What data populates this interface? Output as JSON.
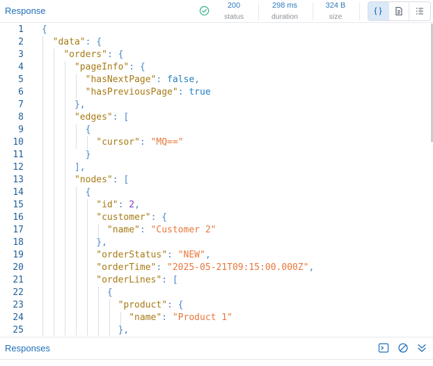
{
  "panel": {
    "title": "Response"
  },
  "stats": {
    "status_value": "200",
    "status_label": "status",
    "duration_value": "298 ms",
    "duration_label": "duration",
    "size_value": "324 B",
    "size_label": "size"
  },
  "colors": {
    "accent": "#1c6fb8",
    "success": "#3fb68b"
  },
  "line_numbers": [
    "1",
    "2",
    "3",
    "4",
    "5",
    "6",
    "7",
    "8",
    "9",
    "10",
    "11",
    "12",
    "13",
    "14",
    "15",
    "16",
    "17",
    "18",
    "19",
    "20",
    "21",
    "22",
    "23",
    "24",
    "25"
  ],
  "code": {
    "l1_p": "{",
    "l2_k": "\"data\"",
    "l2_p": ": {",
    "l3_k": "\"orders\"",
    "l3_p": ": {",
    "l4_k": "\"pageInfo\"",
    "l4_p": ": {",
    "l5_k": "\"hasNextPage\"",
    "l5_p": ": ",
    "l5_v": "false",
    "l5_e": ",",
    "l6_k": "\"hasPreviousPage\"",
    "l6_p": ": ",
    "l6_v": "true",
    "l7_p": "},",
    "l8_k": "\"edges\"",
    "l8_p": ": [",
    "l9_p": "{",
    "l10_k": "\"cursor\"",
    "l10_p": ": ",
    "l10_v": "\"MQ==\"",
    "l11_p": "}",
    "l12_p": "],",
    "l13_k": "\"nodes\"",
    "l13_p": ": [",
    "l14_p": "{",
    "l15_k": "\"id\"",
    "l15_p": ": ",
    "l15_v": "2",
    "l15_e": ",",
    "l16_k": "\"customer\"",
    "l16_p": ": {",
    "l17_k": "\"name\"",
    "l17_p": ": ",
    "l17_v": "\"Customer 2\"",
    "l18_p": "},",
    "l19_k": "\"orderStatus\"",
    "l19_p": ": ",
    "l19_v": "\"NEW\"",
    "l19_e": ",",
    "l20_k": "\"orderTime\"",
    "l20_p": ": ",
    "l20_v": "\"2025-05-21T09:15:00.000Z\"",
    "l20_e": ",",
    "l21_k": "\"orderLines\"",
    "l21_p": ": [",
    "l22_p": "{",
    "l23_k": "\"product\"",
    "l23_p": ": {",
    "l24_k": "\"name\"",
    "l24_p": ": ",
    "l24_v": "\"Product 1\"",
    "l25_p": "},"
  },
  "footer": {
    "title": "Responses"
  }
}
